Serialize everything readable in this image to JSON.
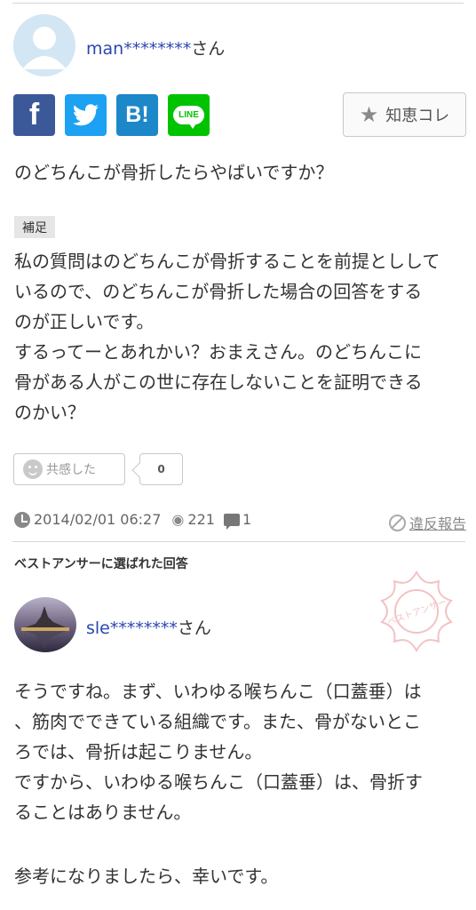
{
  "question": {
    "username_masked": "man********",
    "honorific": "さん",
    "share_hatena": "B!",
    "share_line": "LINE",
    "chie_button": "知恵コレ",
    "title": "のどちんこが骨折したらやばいですか？",
    "supplement_label": "補足",
    "supplement_lines": [
      "私の質問はのどちんこが骨折することを前提としして",
      "いるので、のどちんこが骨折した場合の回答をする",
      "のが正しいです。",
      "するってーとあれかい？おまえさん。のどちんこに",
      "骨がある人がこの世に存在しないことを証明できる",
      "のかい？"
    ],
    "empathy_label": "共感した",
    "empathy_count": "0",
    "date": "2014/02/01 06:27",
    "views": "221",
    "comments": "1",
    "report_link": "違反報告"
  },
  "best_answer": {
    "label": "ベストアンサーに選ばれた回答",
    "username_masked": "sle********",
    "honorific": "さん",
    "stamp_text": "ベストアンサー",
    "lines": [
      "そうですね。まず、いわゆる喉ちんこ（口蓋垂）は",
      "、筋肉でできている組織です。また、骨がないとこ",
      "ろでは、骨折は起こりません。",
      "ですから、いわゆる喉ちんこ（口蓋垂）は、骨折す",
      "ることはありません。",
      "",
      "参考になりましたら、幸いです。"
    ]
  },
  "colors": {
    "facebook": "#3b5998",
    "twitter": "#1da1f2",
    "hatena": "#1c87c9",
    "line": "#00c300",
    "username": "#2a47b0",
    "stamp": "#f2c3c3"
  }
}
